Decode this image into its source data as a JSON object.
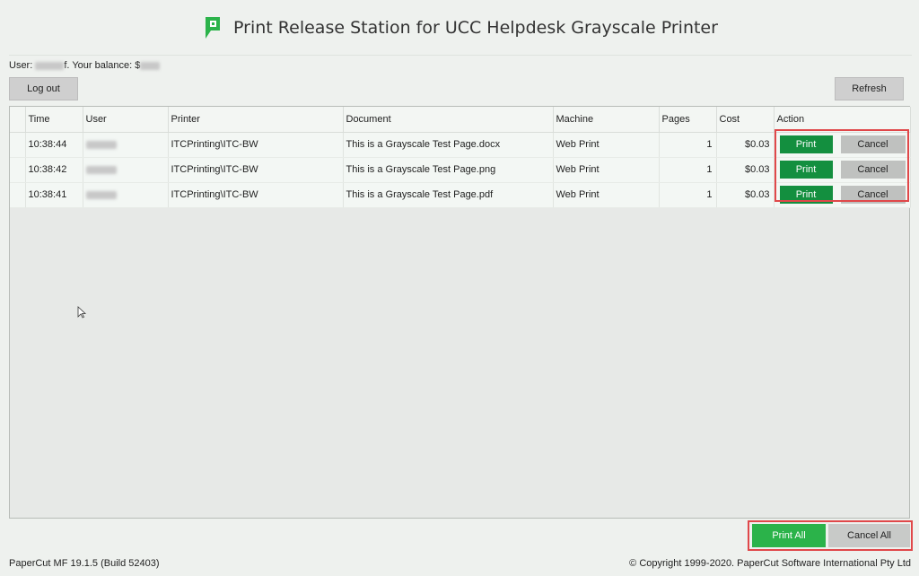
{
  "header": {
    "title": "Print Release Station for UCC Helpdesk Grayscale Printer",
    "logo_icon": "papercut-logo-icon",
    "brand_color": "#2bb34a"
  },
  "user": {
    "label_prefix": "User: ",
    "name_visible_suffix": "f",
    "balance_label": ". Your balance: $"
  },
  "toolbar": {
    "logout_label": "Log out",
    "refresh_label": "Refresh"
  },
  "table": {
    "columns": [
      "Time",
      "User",
      "Printer",
      "Document",
      "Machine",
      "Pages",
      "Cost",
      "Action"
    ],
    "rows": [
      {
        "time": "10:38:44",
        "printer": "ITCPrinting\\ITC-BW",
        "document": "This is a Grayscale Test Page.docx",
        "machine": "Web Print",
        "pages": "1",
        "cost": "$0.03",
        "print_label": "Print",
        "cancel_label": "Cancel"
      },
      {
        "time": "10:38:42",
        "printer": "ITCPrinting\\ITC-BW",
        "document": "This is a Grayscale Test Page.png",
        "machine": "Web Print",
        "pages": "1",
        "cost": "$0.03",
        "print_label": "Print",
        "cancel_label": "Cancel"
      },
      {
        "time": "10:38:41",
        "printer": "ITCPrinting\\ITC-BW",
        "document": "This is a Grayscale Test Page.pdf",
        "machine": "Web Print",
        "pages": "1",
        "cost": "$0.03",
        "print_label": "Print",
        "cancel_label": "Cancel"
      }
    ]
  },
  "bulk": {
    "print_all_label": "Print All",
    "cancel_all_label": "Cancel All"
  },
  "footer": {
    "version": "PaperCut MF  19.1.5 (Build 52403)",
    "copyright": "© Copyright 1999-2020. PaperCut Software International Pty Ltd"
  },
  "colors": {
    "print_button": "#138f3f",
    "highlight_border": "#e0484a"
  }
}
